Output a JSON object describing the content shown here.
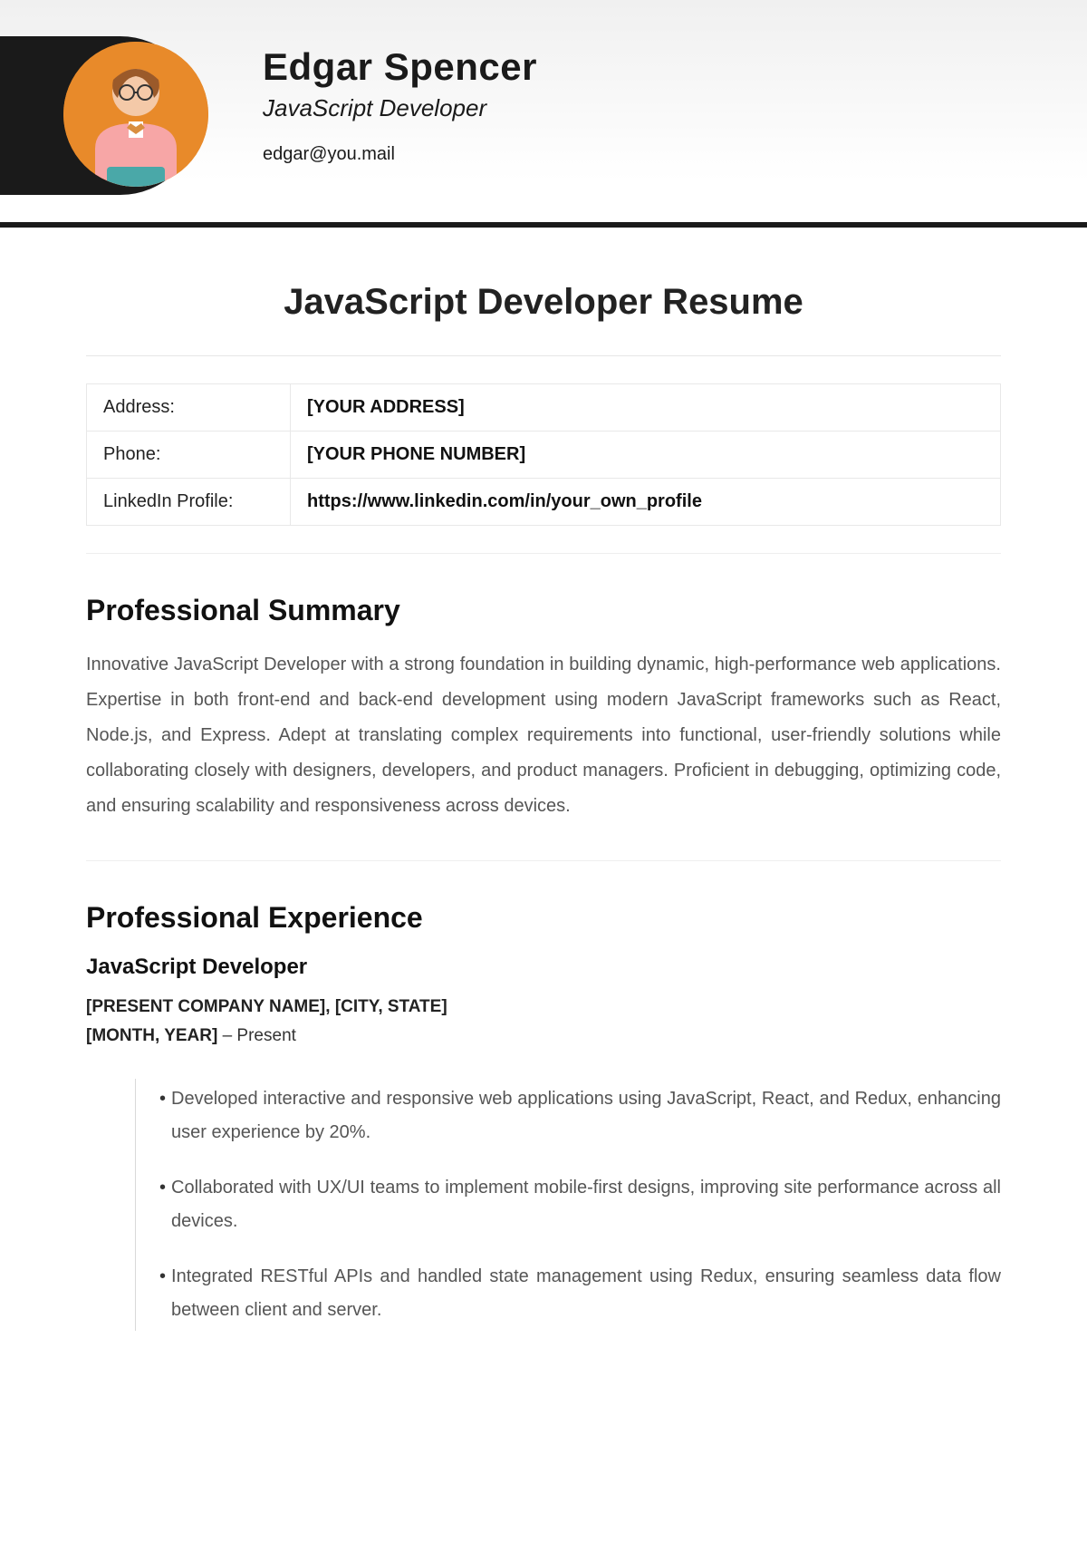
{
  "header": {
    "name": "Edgar Spencer",
    "role": "JavaScript Developer",
    "email": "edgar@you.mail"
  },
  "doc_title": "JavaScript Developer Resume",
  "info": [
    {
      "label": "Address:",
      "value": "[YOUR ADDRESS]"
    },
    {
      "label": "Phone:",
      "value": "[YOUR PHONE NUMBER]"
    },
    {
      "label": "LinkedIn Profile:",
      "value": "https://www.linkedin.com/in/your_own_profile"
    }
  ],
  "summary": {
    "heading": "Professional Summary",
    "text": "Innovative JavaScript Developer with a strong foundation in building dynamic, high-performance web applications. Expertise in both front-end and back-end development using modern JavaScript frameworks such as React, Node.js, and Express. Adept at translating complex requirements into functional, user-friendly solutions while collaborating closely with designers, developers, and product managers. Proficient in debugging, optimizing code, and ensuring scalability and responsiveness across devices."
  },
  "experience": {
    "heading": "Professional Experience",
    "job": {
      "title": "JavaScript Developer",
      "company_line": "[PRESENT COMPANY NAME], [CITY, STATE]",
      "date_prefix": "[MONTH, YEAR]",
      "date_suffix": " – Present",
      "bullets": [
        "Developed interactive and responsive web applications using JavaScript, React, and Redux, enhancing user experience by 20%.",
        "Collaborated with UX/UI teams to implement mobile-first designs, improving site performance across all devices.",
        "Integrated RESTful APIs and handled state management using Redux, ensuring seamless data flow between client and server."
      ]
    }
  }
}
